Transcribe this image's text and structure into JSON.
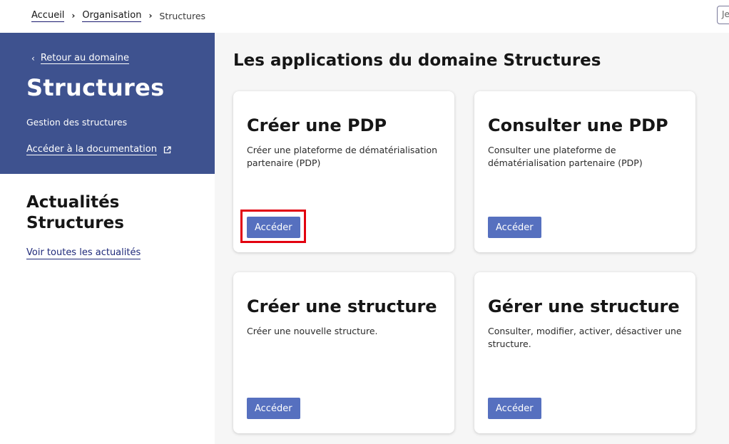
{
  "breadcrumb": {
    "items": [
      "Accueil",
      "Organisation"
    ],
    "current": "Structures",
    "separator": "›"
  },
  "search_stub": "Je",
  "domain": {
    "back_label": "Retour au domaine",
    "title": "Structures",
    "description": "Gestion des structures",
    "doc_link": "Accéder à la documentation"
  },
  "news": {
    "title_line1": "Actualités",
    "title_line2": "Structures",
    "link": "Voir toutes les actualités"
  },
  "main": {
    "title": "Les applications du domaine Structures",
    "cards": [
      {
        "title": "Créer une PDP",
        "description": "Créer une plateforme de dématérialisation partenaire (PDP)",
        "button": "Accéder"
      },
      {
        "title": "Consulter une PDP",
        "description": "Consulter une plateforme de dématérialisation partenaire (PDP)",
        "button": "Accéder"
      },
      {
        "title": "Créer une structure",
        "description": "Créer une nouvelle structure.",
        "button": "Accéder"
      },
      {
        "title": "Gérer une structure",
        "description": "Consulter, modifier, activer, désactiver une structure.",
        "button": "Accéder"
      }
    ]
  },
  "colors": {
    "panel": "#3e528f",
    "button": "#5670bf",
    "highlight": "#e2000f"
  }
}
